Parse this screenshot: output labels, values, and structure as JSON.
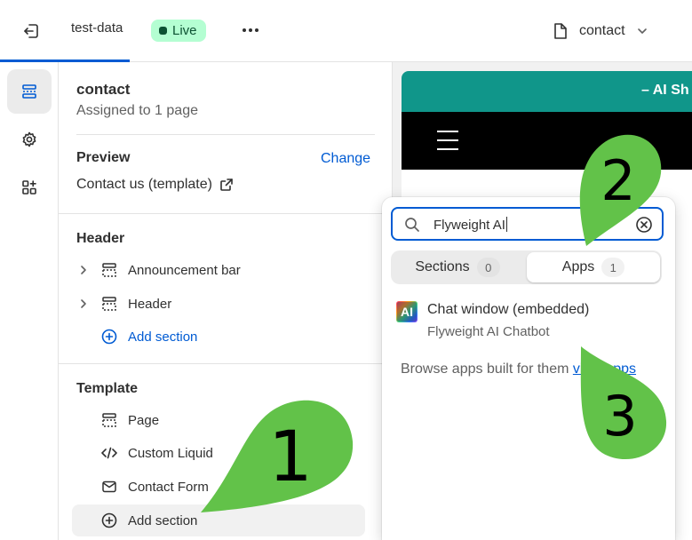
{
  "topbar": {
    "store_name": "test-data",
    "status_badge": "Live",
    "page_selector": "contact"
  },
  "panel": {
    "title": "contact",
    "subtitle": "Assigned to 1 page",
    "preview_heading": "Preview",
    "preview_change": "Change",
    "preview_template": "Contact us (template)",
    "header_heading": "Header",
    "header_items": [
      "Announcement bar",
      "Header"
    ],
    "add_section": "Add section",
    "template_heading": "Template",
    "template_items": [
      "Page",
      "Custom Liquid",
      "Contact Form"
    ]
  },
  "preview": {
    "announcement_text": "– AI Sh"
  },
  "popover": {
    "search_value": "Flyweight AI",
    "tabs": [
      {
        "label": "Sections",
        "count": "0"
      },
      {
        "label": "Apps",
        "count": "1"
      }
    ],
    "result_logo": "AI",
    "result_title": "Chat window (embedded)",
    "result_subtitle": "Flyweight AI Chatbot",
    "browse_text": "Browse apps built for them",
    "browse_link": "view apps"
  },
  "markers": [
    "1",
    "2",
    "3"
  ],
  "colors": {
    "accent": "#005bd3",
    "live_badge_bg": "#b4fed2",
    "announcement_bg": "#10968a",
    "marker_green": "#62c249"
  }
}
